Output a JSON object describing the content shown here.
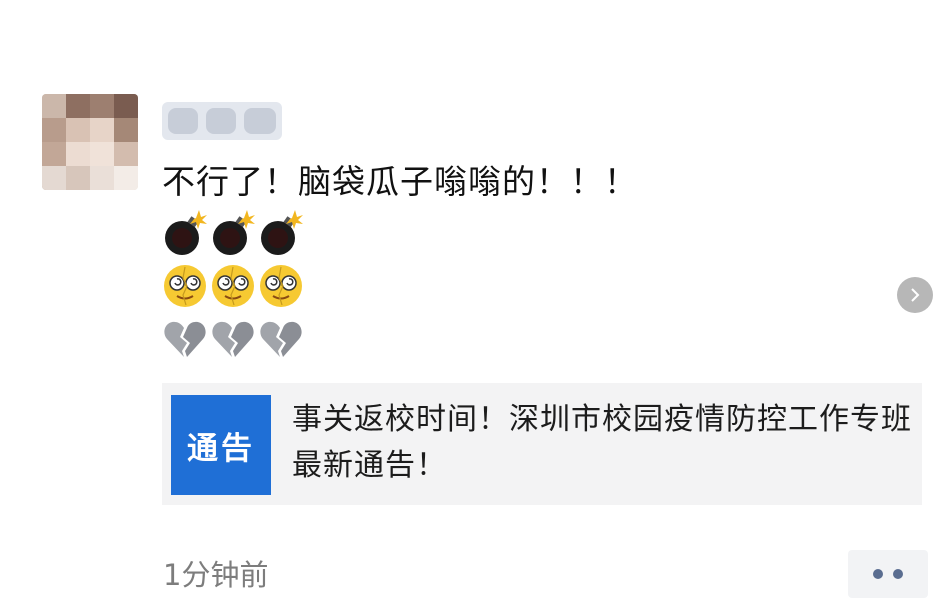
{
  "post": {
    "text": "不行了！脑袋瓜子嗡嗡的！！！",
    "emoji_rows": [
      [
        "bomb-icon",
        "bomb-icon",
        "bomb-icon"
      ],
      [
        "dizzy-face-icon",
        "dizzy-face-icon",
        "dizzy-face-icon"
      ],
      [
        "broken-heart-icon",
        "broken-heart-icon",
        "broken-heart-icon"
      ]
    ]
  },
  "shared_article": {
    "thumbnail_text": "通告",
    "thumbnail_color": "#1f6fd6",
    "title": "事关返校时间！深圳市校园疫情防控工作专班最新通告！"
  },
  "meta": {
    "time": "1分钟前"
  },
  "icons": {
    "action": "more-dots-icon",
    "nav": "chevron-right-icon"
  }
}
